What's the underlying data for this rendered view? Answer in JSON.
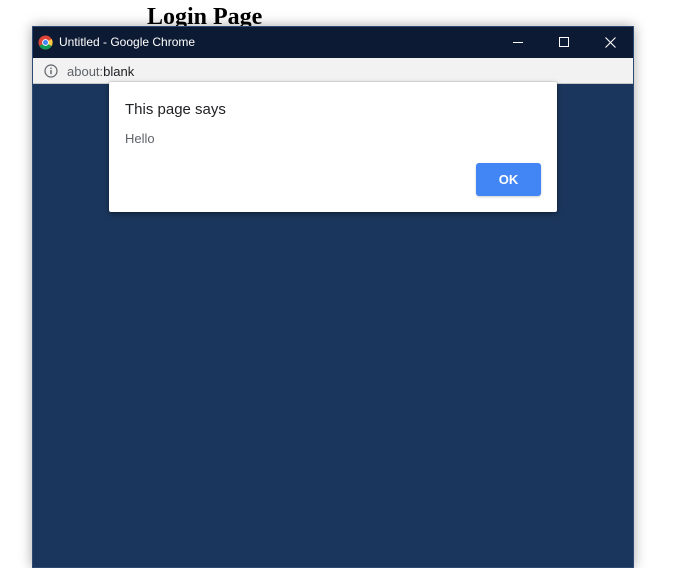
{
  "page": {
    "heading": "Login Page"
  },
  "window": {
    "title": "Untitled - Google Chrome",
    "icon": "chrome-logo-icon",
    "content_background": "#1b365c",
    "titlebar_background": "#0d1a33",
    "controls": {
      "minimize_icon": "minimize-icon",
      "maximize_icon": "maximize-icon",
      "close_icon": "close-icon"
    }
  },
  "address_bar": {
    "icon": "info-icon",
    "scheme": "about:",
    "rest": "blank"
  },
  "dialog": {
    "title": "This page says",
    "message": "Hello",
    "ok_label": "OK",
    "accent": "#4285f4"
  }
}
